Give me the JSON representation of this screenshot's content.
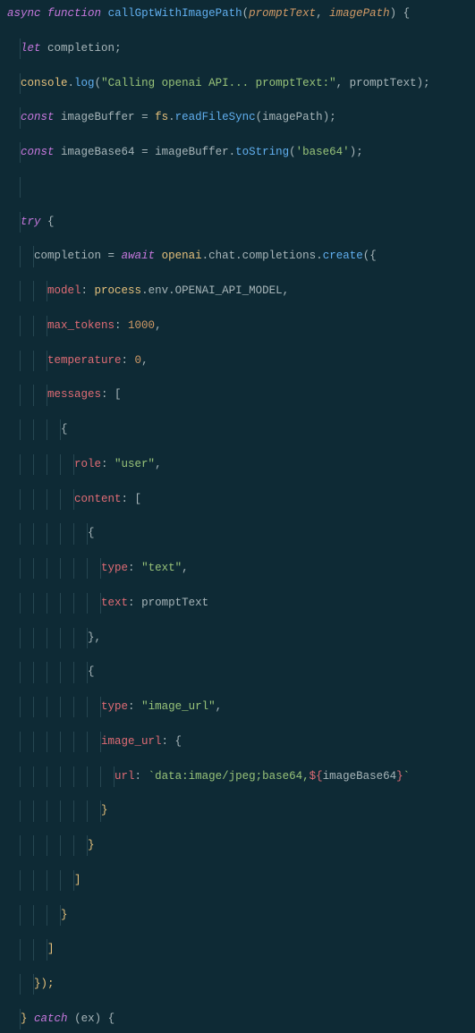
{
  "code": {
    "fn_decl": {
      "async": "async",
      "function": "function",
      "name": "callGptWithImagePath",
      "p1": "promptText",
      "p2": "imagePath"
    },
    "l2": {
      "let": "let",
      "var": "completion"
    },
    "l3": {
      "obj": "console",
      "method": "log",
      "str": "\"Calling openai API... promptText:\"",
      "arg": "promptText"
    },
    "l4": {
      "const": "const",
      "var": "imageBuffer",
      "obj": "fs",
      "method": "readFileSync",
      "arg": "imagePath"
    },
    "l5": {
      "const": "const",
      "var": "imageBase64",
      "obj": "imageBuffer",
      "method": "toString",
      "arg": "'base64'"
    },
    "l7": {
      "try": "try"
    },
    "l8": {
      "lhs": "completion",
      "await": "await",
      "chain_obj": "openai",
      "chain_p1": "chat",
      "chain_p2": "completions",
      "chain_m": "create"
    },
    "l9": {
      "key": "model",
      "obj": "process",
      "prop1": "env",
      "prop2": "OPENAI_API_MODEL"
    },
    "l10": {
      "key": "max_tokens",
      "val": "1000"
    },
    "l11": {
      "key": "temperature",
      "val": "0"
    },
    "l12": {
      "key": "messages"
    },
    "l14": {
      "key": "role",
      "val": "\"user\""
    },
    "l15": {
      "key": "content"
    },
    "l17": {
      "key": "type",
      "val": "\"text\""
    },
    "l18": {
      "key": "text",
      "val": "promptText"
    },
    "l21": {
      "key": "type",
      "val": "\"image_url\""
    },
    "l22": {
      "key": "image_url"
    },
    "l23": {
      "key": "url",
      "tpl_a": "`data:image/jpeg;base64,",
      "tpl_v": "${",
      "tpl_id": "imageBase64",
      "tpl_e": "}",
      "tpl_z": "`"
    },
    "l30": {
      "catch": "catch",
      "ex": "ex"
    }
  }
}
